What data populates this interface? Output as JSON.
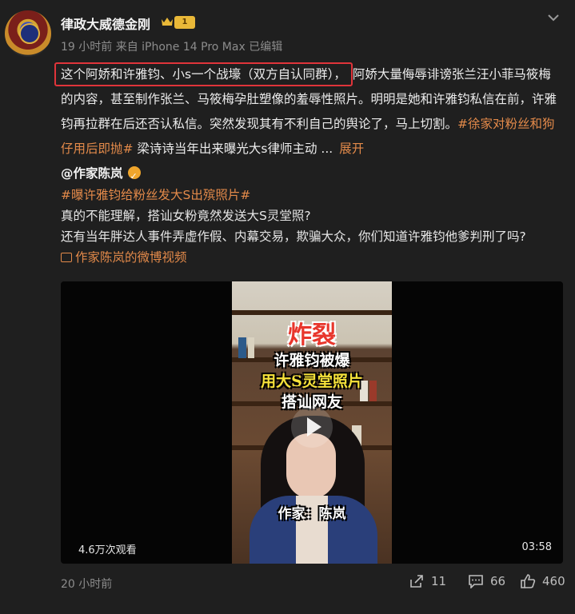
{
  "post": {
    "username": "律政大威德金刚",
    "vip_level": "1",
    "meta": "19 小时前  来自 iPhone 14 Pro Max 已编辑",
    "text_highlight": "这个阿娇和许雅钧、小s一个战壕（双方自认同群），",
    "text_rest": "阿娇大量侮辱诽谤张兰汪小菲马筱梅的内容，甚至制作张兰、马筱梅孕肚塑像的羞辱性照片。明明是她和许雅钧私信在前，许雅钧再拉群在后还否认私信。突然发现其有不利自己的舆论了，马上切割。",
    "tag": "#徐家对粉丝和狗仔用后即抛#",
    "text_tail": " 梁诗诗当年出来曝光大s律师主动 ...",
    "more_label": "展开"
  },
  "repost": {
    "author": "@作家陈岚",
    "tag": "#曝许雅钧给粉丝发大S出殡照片#",
    "line1": "真的不能理解，搭讪女粉竟然发送大S灵堂照?",
    "line2": "还有当年胖达人事件弄虚作假、内幕交易，欺骗大众，你们知道许雅钧他爹判刑了吗?",
    "video_link": "作家陈岚的微博视频"
  },
  "video": {
    "overlay_1": "炸裂",
    "overlay_2": "许雅钧被爆",
    "overlay_3": "用大S灵堂照片",
    "overlay_4": "搭讪网友",
    "overlay_5": "作家：陈岚",
    "views": "4.6万次观看",
    "duration": "03:58"
  },
  "footer": {
    "time": "20 小时前",
    "share_count": "11",
    "comment_count": "66",
    "like_count": "460"
  },
  "colors": {
    "background": "#1f1f1f",
    "link_orange": "#e38a4a",
    "highlight_red": "#e0343a",
    "vip_gold": "#e9b838"
  }
}
